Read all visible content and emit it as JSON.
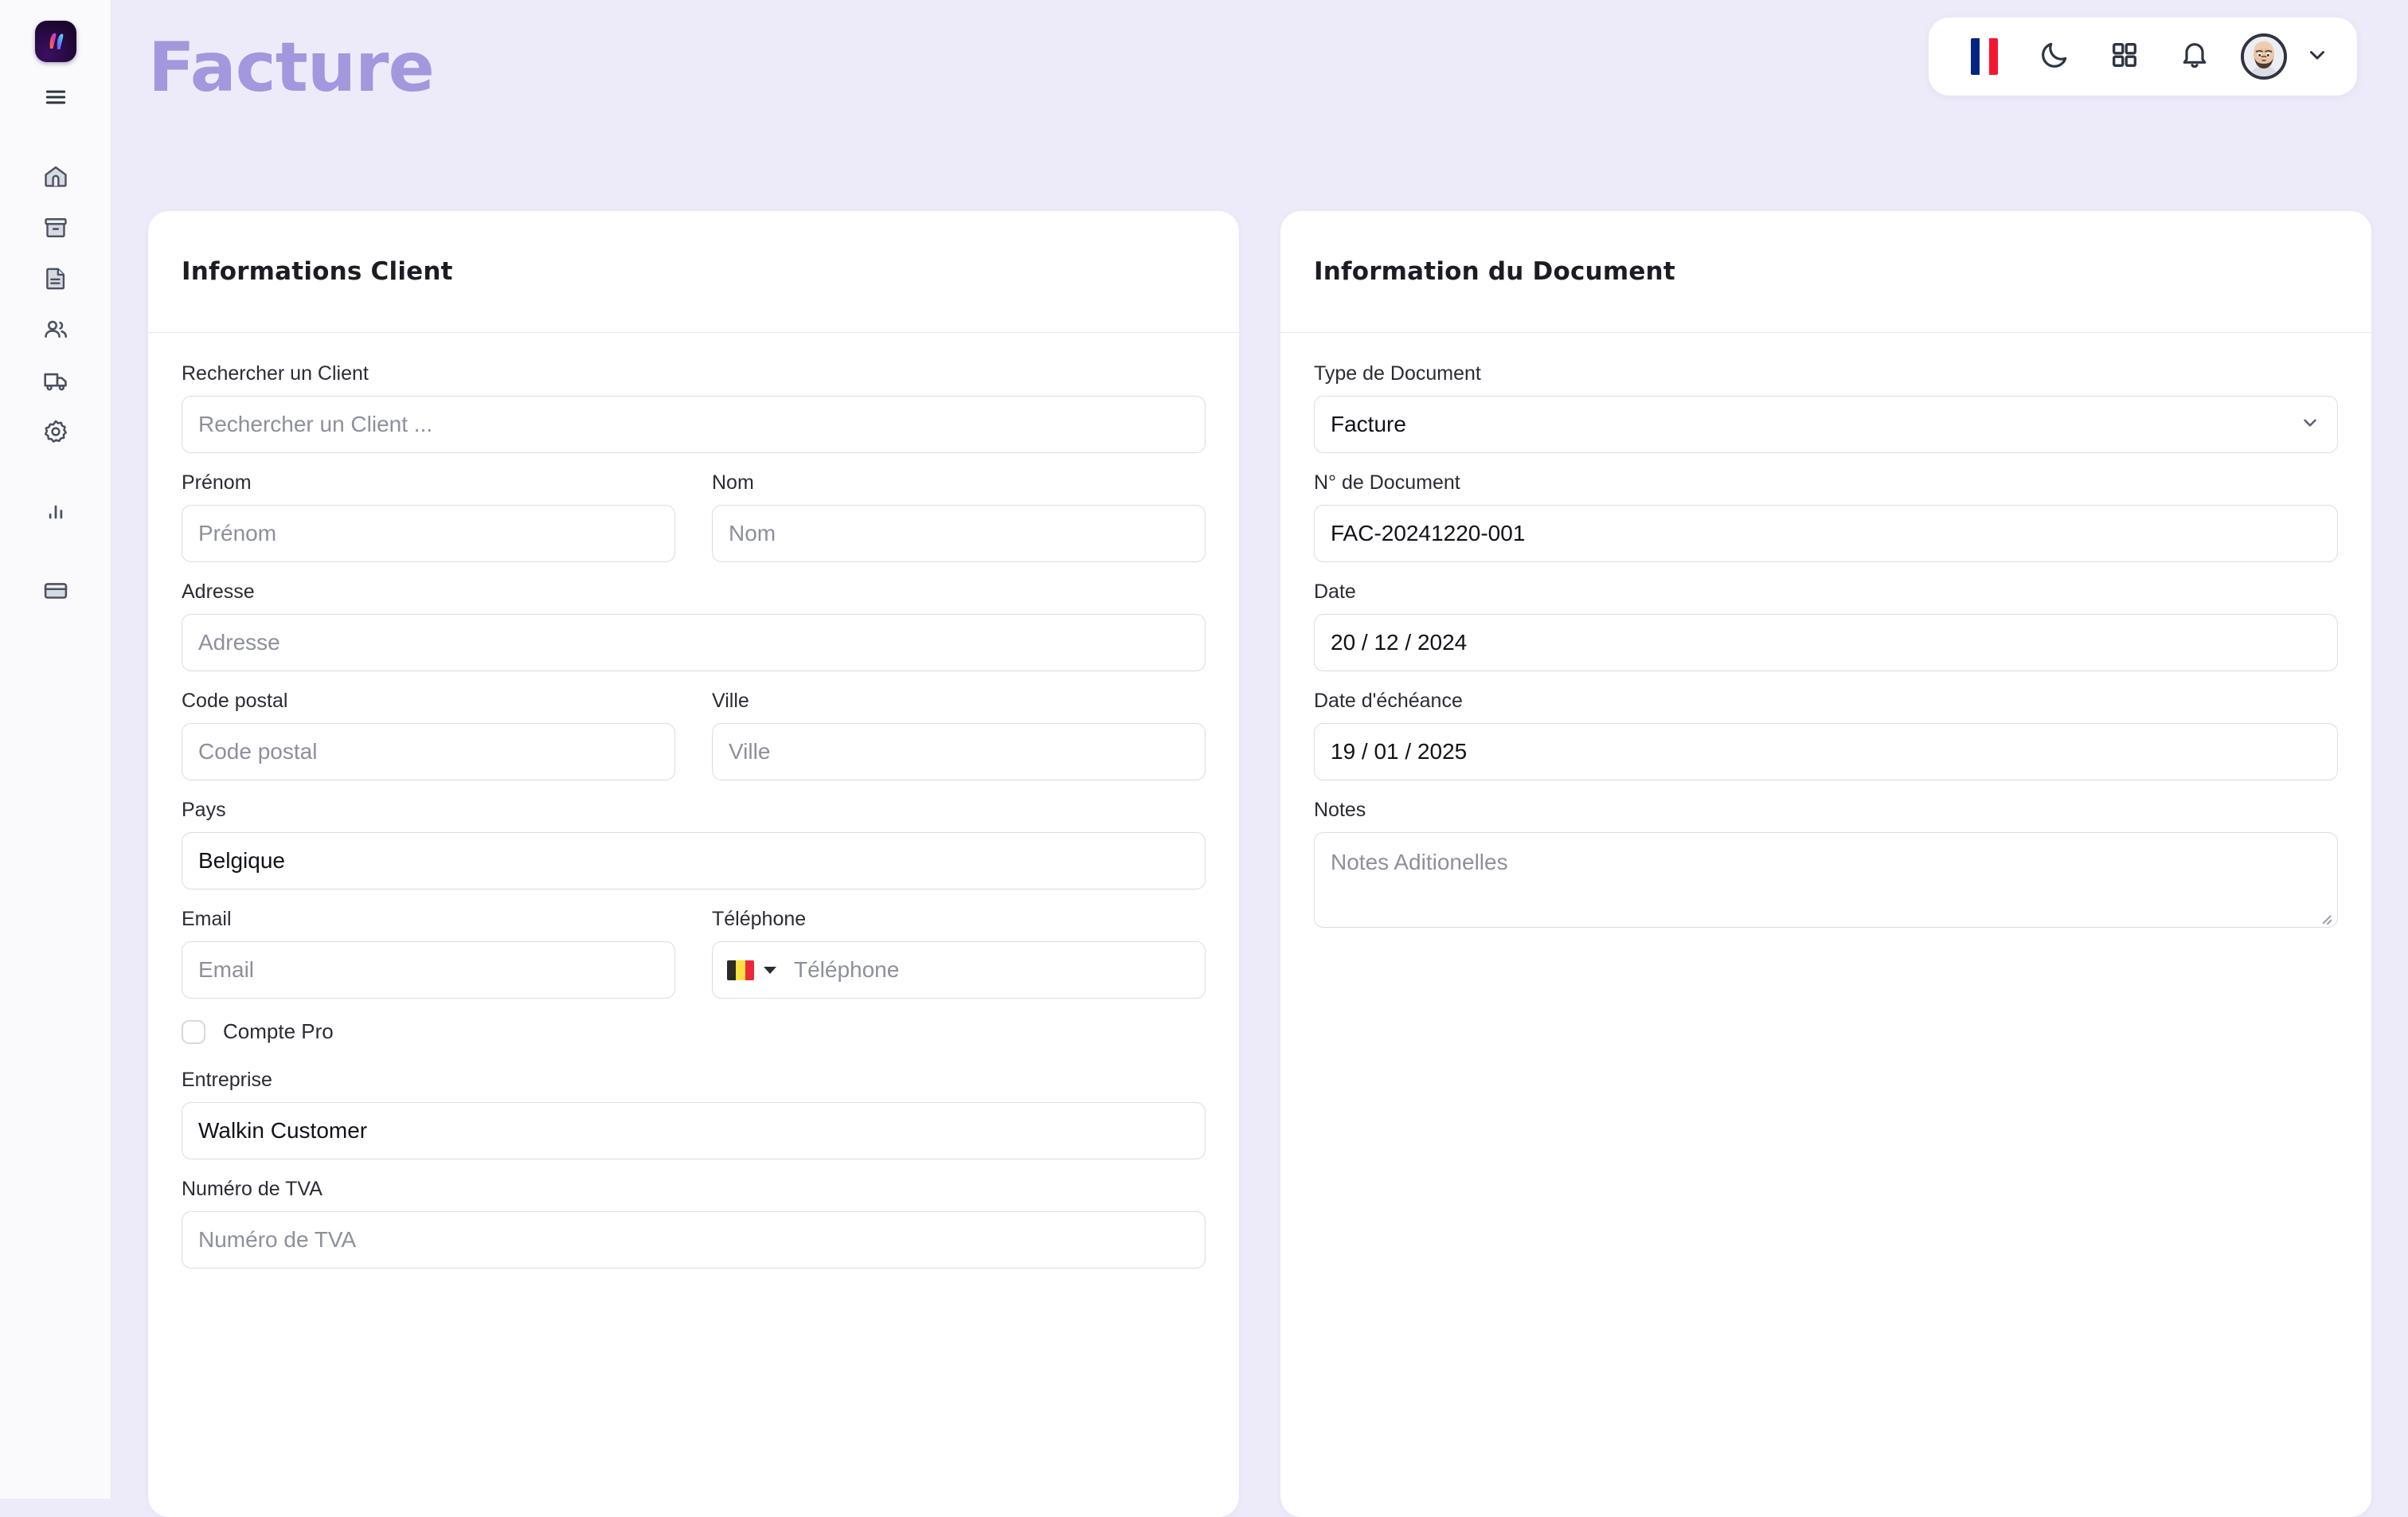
{
  "app": {
    "logo_name": "app-logo",
    "background_color": "#edebf9",
    "accent_color": "#a397dd"
  },
  "page": {
    "title": "Facture"
  },
  "sidebar": {
    "items": [
      {
        "icon": "menu-icon",
        "label": "Menu"
      },
      {
        "icon": "home-icon",
        "label": "Accueil"
      },
      {
        "icon": "archive-icon",
        "label": "Archive"
      },
      {
        "icon": "document-icon",
        "label": "Documents"
      },
      {
        "icon": "users-icon",
        "label": "Clients"
      },
      {
        "icon": "truck-icon",
        "label": "Livraison"
      },
      {
        "icon": "gear-icon",
        "label": "Parametres"
      },
      {
        "icon": "bar-chart-icon",
        "label": "Statistiques"
      },
      {
        "icon": "credit-card-icon",
        "label": "Paiements"
      }
    ]
  },
  "header": {
    "language_flag": "flag-fr-icon",
    "dark_mode_icon": "moon-icon",
    "apps_icon": "grid-apps-icon",
    "notifications_icon": "bell-icon",
    "avatar_icon": "user-avatar",
    "chevron_icon": "chevron-down-icon"
  },
  "client_card": {
    "title": "Informations Client",
    "search": {
      "label": "Rechercher un Client",
      "placeholder": "Rechercher un Client ...",
      "value": ""
    },
    "firstname": {
      "label": "Prénom",
      "placeholder": "Prénom",
      "value": ""
    },
    "lastname": {
      "label": "Nom",
      "placeholder": "Nom",
      "value": ""
    },
    "address": {
      "label": "Adresse",
      "placeholder": "Adresse",
      "value": ""
    },
    "postal_code": {
      "label": "Code postal",
      "placeholder": "Code postal",
      "value": ""
    },
    "city": {
      "label": "Ville",
      "placeholder": "Ville",
      "value": ""
    },
    "country": {
      "label": "Pays",
      "value": "Belgique"
    },
    "email": {
      "label": "Email",
      "placeholder": "Email",
      "value": ""
    },
    "phone": {
      "label": "Téléphone",
      "placeholder": "Téléphone",
      "value": "",
      "country_flag": "flag-be-icon"
    },
    "pro_account": {
      "label": "Compte Pro",
      "checked": false
    },
    "company": {
      "label": "Entreprise",
      "value": "Walkin Customer"
    },
    "vat_number": {
      "label": "Numéro de TVA",
      "placeholder": "Numéro de TVA",
      "value": ""
    }
  },
  "document_card": {
    "title": "Information du Document",
    "doc_type": {
      "label": "Type de Document",
      "value": "Facture"
    },
    "doc_number": {
      "label": "N° de Document",
      "value": "FAC-20241220-001"
    },
    "date": {
      "label": "Date",
      "value": "20 / 12 / 2024"
    },
    "due_date": {
      "label": "Date d'échéance",
      "value": "19 / 01 / 2025"
    },
    "notes": {
      "label": "Notes",
      "placeholder": "Notes Aditionelles",
      "value": ""
    }
  }
}
